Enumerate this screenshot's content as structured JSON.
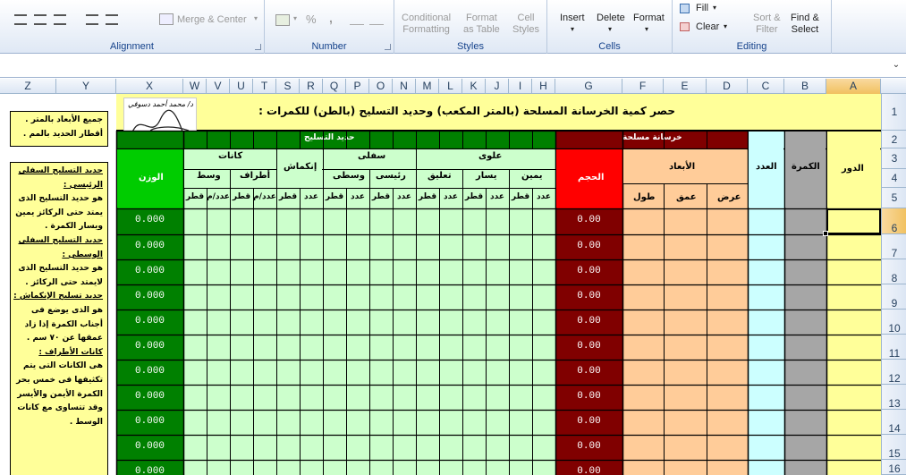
{
  "ribbon": {
    "alignment": {
      "label": "Alignment",
      "merge_label": "Merge & Center"
    },
    "number": {
      "label": "Number",
      "percent": "%",
      "comma": ","
    },
    "styles": {
      "label": "Styles",
      "cond_fmt": [
        "Conditional",
        "Formatting"
      ],
      "fmt_table": [
        "Format",
        "as Table"
      ],
      "cell_styles": [
        "Cell",
        "Styles"
      ]
    },
    "cells": {
      "label": "Cells",
      "insert": "Insert",
      "delete": "Delete",
      "format": "Format"
    },
    "editing": {
      "label": "Editing",
      "fill": "Fill",
      "clear": "Clear",
      "sort": [
        "Sort &",
        "Filter"
      ],
      "find": [
        "Find &",
        "Select"
      ]
    }
  },
  "columns": [
    "Z",
    "Y",
    "X",
    "W",
    "V",
    "U",
    "T",
    "S",
    "R",
    "Q",
    "P",
    "O",
    "N",
    "M",
    "L",
    "K",
    "J",
    "I",
    "H",
    "G",
    "F",
    "E",
    "D",
    "C",
    "B",
    "A"
  ],
  "selected_column": "A",
  "rows": [
    "1",
    "2",
    "3",
    "4",
    "5",
    "6",
    "7",
    "8",
    "9",
    "10",
    "11",
    "12",
    "13",
    "14",
    "15",
    "16"
  ],
  "selected_row": "6",
  "sheet": {
    "title": "حصر كمية الخرسانة المسلحة (بالمتر المكعب) وحديد التسليح (بالطن) للكمرات :",
    "signature": "د/ محمد أحمد دسوقي",
    "note1": [
      "جميع الأبعاد بالمتر .",
      "أقطار الحديد بالمم ."
    ],
    "note2": [
      {
        "text": "حديد التسليح السفلى",
        "u": true
      },
      {
        "text": "الرئيسى :",
        "u": true
      },
      {
        "text": "هو حديد التسليح الذى",
        "u": false
      },
      {
        "text": "يمتد حتى الركائز يمين",
        "u": false
      },
      {
        "text": "ويسار الكمرة .",
        "u": false
      },
      {
        "text": "حديد التسليح السفلى",
        "u": true
      },
      {
        "text": "الوسطى :",
        "u": true
      },
      {
        "text": "هو حديد التسليح الذى",
        "u": false
      },
      {
        "text": "لايمتد حتى الركائز .",
        "u": false
      },
      {
        "text": "حديد تسليح الإنكماش :",
        "u": true
      },
      {
        "text": "هو الذى يوضع فى",
        "u": false
      },
      {
        "text": "أجناب الكمرة إذا زاد",
        "u": false
      },
      {
        "text": "عمقها عن ٧٠ سم .",
        "u": false
      },
      {
        "text": "كانات الأطراف :",
        "u": true
      },
      {
        "text": "هى الكانات التى يتم",
        "u": false
      },
      {
        "text": "تكثيفها فى خمس بحر",
        "u": false
      },
      {
        "text": "الكمرة الأيمن والأيسر",
        "u": false
      },
      {
        "text": "وقد تتساوى مع كانات",
        "u": false
      },
      {
        "text": "الوسط .",
        "u": false
      }
    ],
    "h_steel": "حديد التسليح",
    "h_concrete": "خرسانة مسلحة",
    "h_weight": "الوزن",
    "h_stirrups": "كانات",
    "h_st_mid": "وسط",
    "h_st_end": "أطراف",
    "h_shrink": "إنكماش",
    "h_bottom": "سفلى",
    "h_bot_mid": "وسطى",
    "h_bot_main": "رئيسى",
    "h_top": "علوى",
    "h_hanger": "تعليق",
    "h_left": "يسار",
    "h_right": "يمين",
    "h_volume": "الحجم",
    "h_dims": "الأبعاد",
    "h_len": "طول",
    "h_depth": "عمق",
    "h_width": "عرض",
    "h_count": "العدد",
    "h_beam": "الكمرة",
    "h_floor": "الدور",
    "sub_dia": "قطر",
    "sub_cnt": "عدد",
    "sub_cnt_m": "عدد/م",
    "weight_value": "0.000",
    "volume_value": "0.00"
  },
  "colors": {
    "yellow": "#ffff99",
    "green_dark": "#008000",
    "green_bright": "#00cc00",
    "light_green": "#ccffcc",
    "dark_red": "#800000",
    "red": "#ff0000",
    "orange": "#ffcc99",
    "light_blue": "#ccffff",
    "gray": "#a6a6a6"
  }
}
